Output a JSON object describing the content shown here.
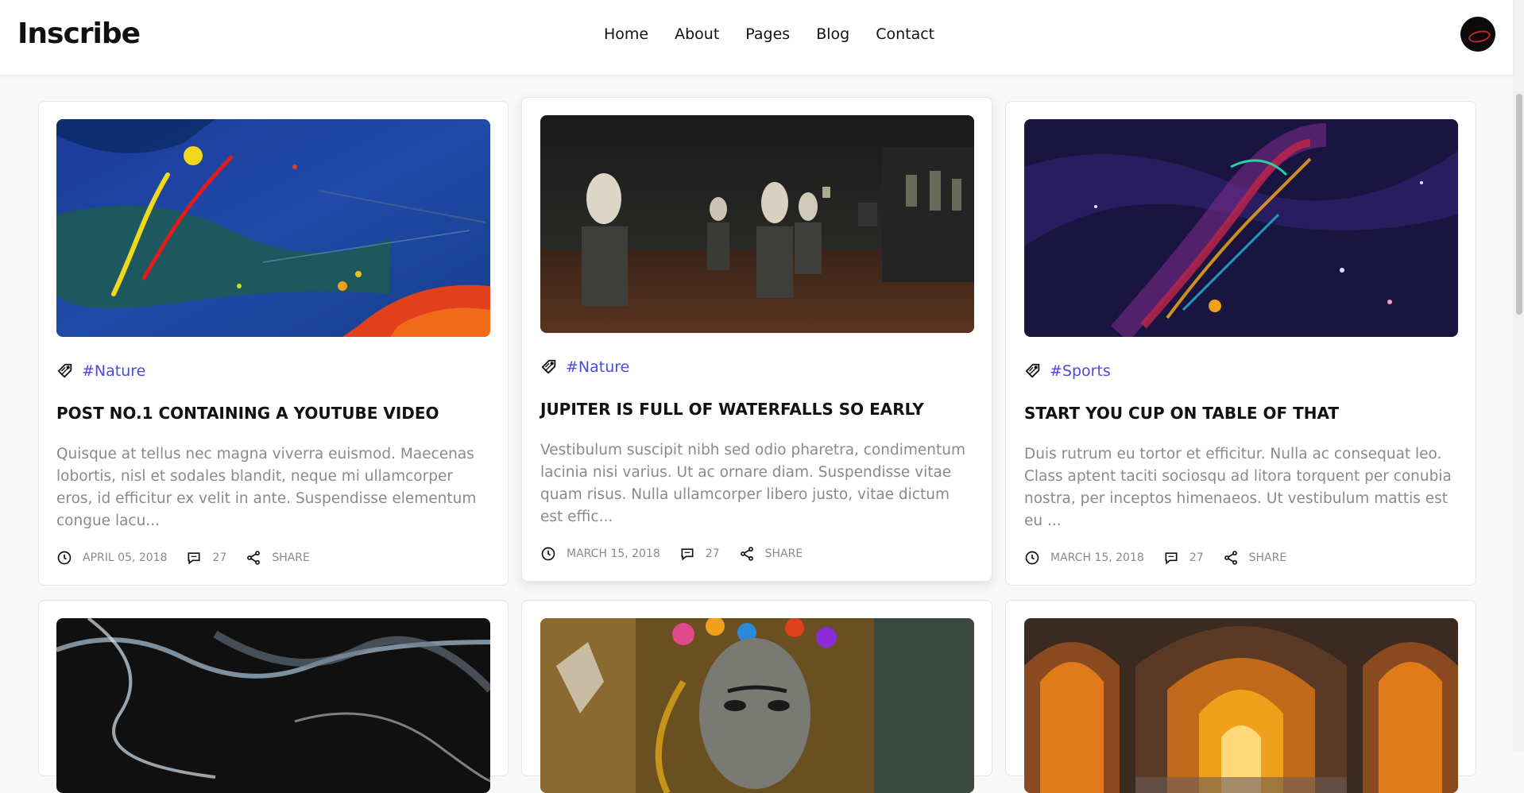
{
  "brand": "Inscribe",
  "nav": [
    "Home",
    "About",
    "Pages",
    "Blog",
    "Contact"
  ],
  "colors": {
    "accent": "#4a4ae0",
    "muted": "#8a8a8a"
  },
  "posts": [
    {
      "tag": "#Nature",
      "title": "POST NO.1 CONTAINING A YOUTUBE VIDEO",
      "excerpt": "Quisque at tellus nec magna viverra euismod. Maecenas lobortis, nisl et sodales blandit, neque mi ullamcorper eros, id efficitur ex velit in ante. Suspendisse elementum congue lacu...",
      "date": "APRIL 05, 2018",
      "comments": "27",
      "share": "SHARE"
    },
    {
      "tag": "#Nature",
      "title": "JUPITER IS FULL OF WATERFALLS SO EARLY",
      "excerpt": "Vestibulum suscipit nibh sed odio pharetra, condimentum lacinia nisi varius. Ut ac ornare diam. Suspendisse vitae quam risus. Nulla ullamcorper libero justo, vitae dictum est effic...",
      "date": "MARCH 15, 2018",
      "comments": "27",
      "share": "SHARE"
    },
    {
      "tag": "#Sports",
      "title": "START YOU CUP ON TABLE OF THAT",
      "excerpt": "Duis rutrum eu tortor et efficitur. Nulla ac consequat leo. Class aptent taciti sociosqu ad litora torquent per conubia nostra, per inceptos himenaeos. Ut vestibulum mattis est eu ...",
      "date": "MARCH 15, 2018",
      "comments": "27",
      "share": "SHARE"
    }
  ]
}
